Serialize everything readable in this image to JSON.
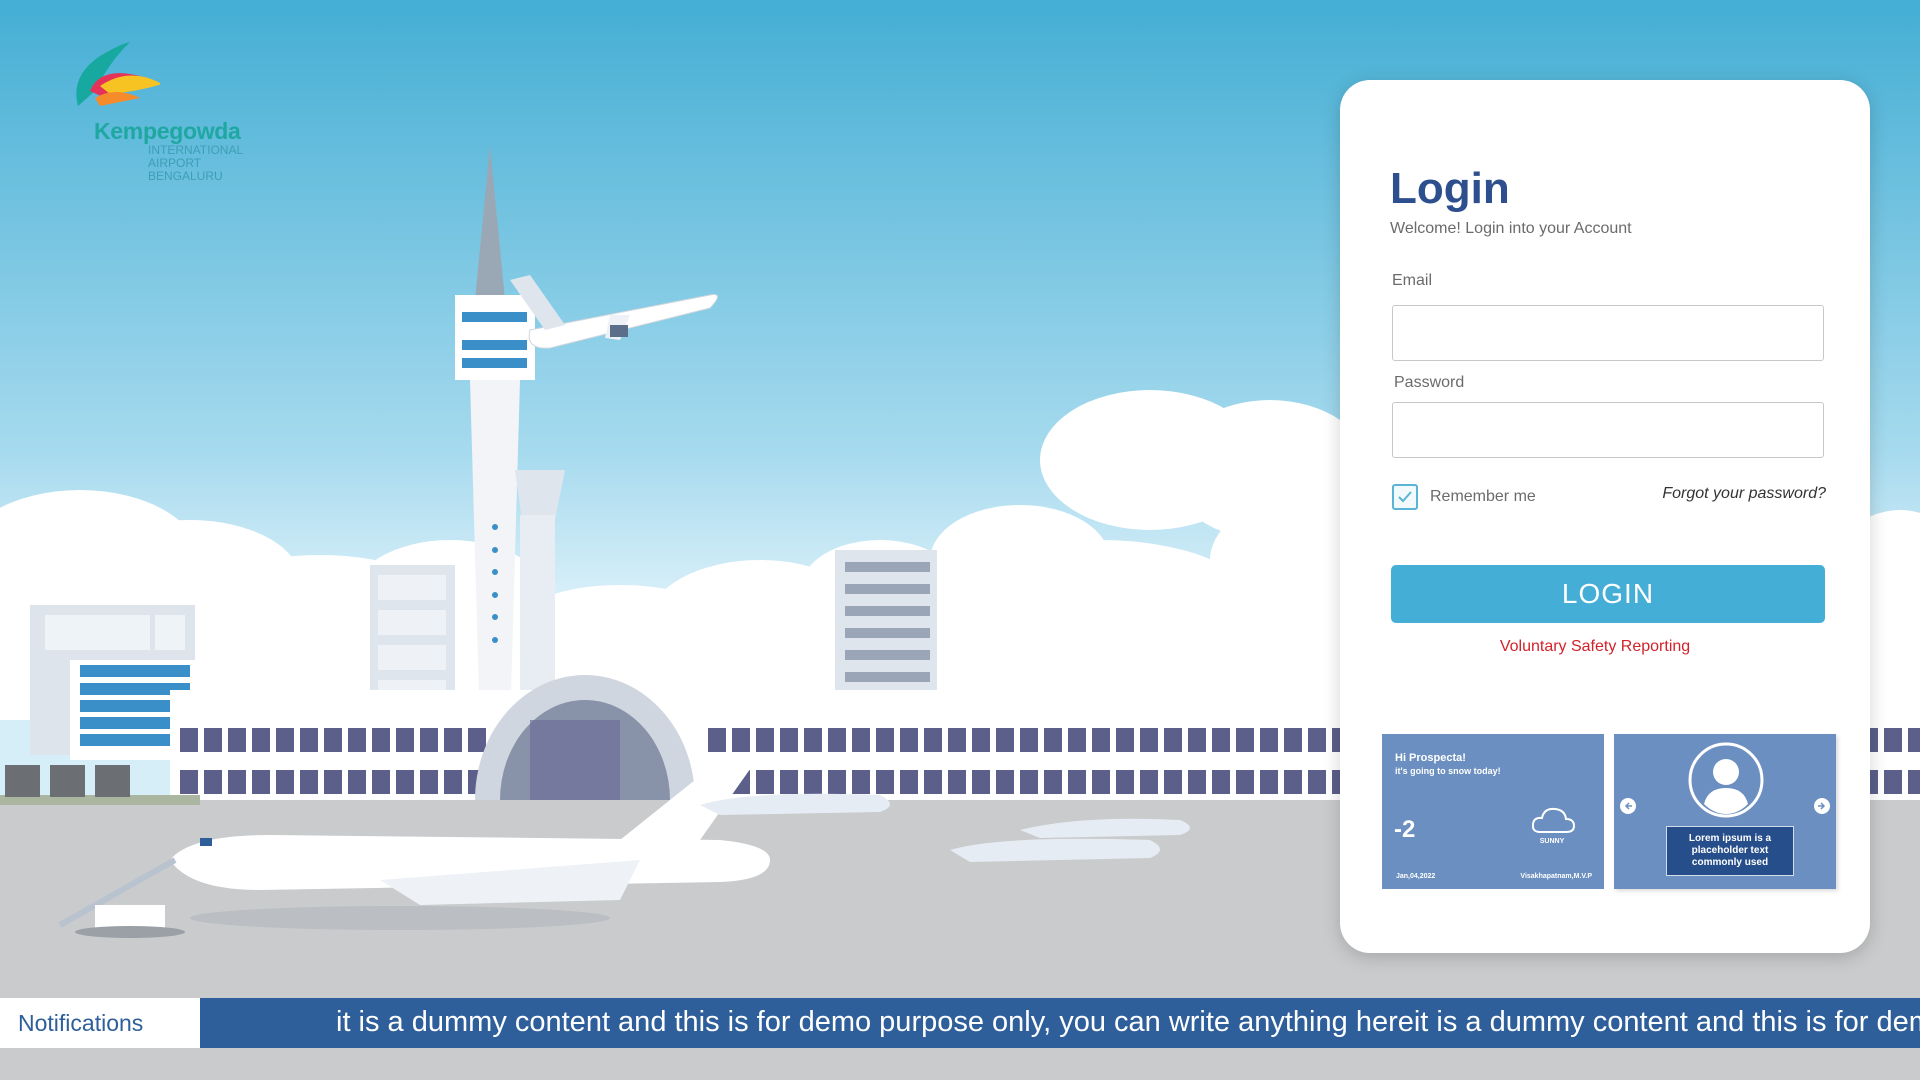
{
  "brand": {
    "name": "Kempegowda",
    "subtitle_lines": [
      "INTERNATIONAL",
      "AIRPORT",
      "BENGALURU"
    ]
  },
  "login": {
    "title": "Login",
    "subtitle": "Welcome! Login into your Account",
    "email_label": "Email",
    "email_value": "",
    "password_label": "Password",
    "password_value": "",
    "remember_label": "Remember me",
    "remember_checked": true,
    "forgot_label": "Forgot your password?",
    "button_label": "LOGIN",
    "safety_link": "Voluntary Safety Reporting"
  },
  "weather_widget": {
    "greeting": "Hi Prospecta!",
    "message": "it's going to snow today!",
    "temperature": "-2",
    "condition": "SUNNY",
    "date": "Jan,04,2022",
    "location": "Visakhapatnam,M.V.P",
    "icon": "cloud-icon"
  },
  "profile_widget": {
    "text": "Lorem ipsum is a placeholder text commonly used",
    "icon": "user-avatar-icon"
  },
  "notifications": {
    "label": "Notifications",
    "ticker_text": "it is a dummy content and this is for demo purpose only, you can write anything hereit is a dummy content and this is for demo purpose only, you can write anything here"
  },
  "colors": {
    "primary": "#2e4f8e",
    "accent": "#45aed6",
    "link_red": "#d2232a",
    "notification_bar": "#2e5f9a",
    "widget_blue": "#6b8fc0"
  }
}
